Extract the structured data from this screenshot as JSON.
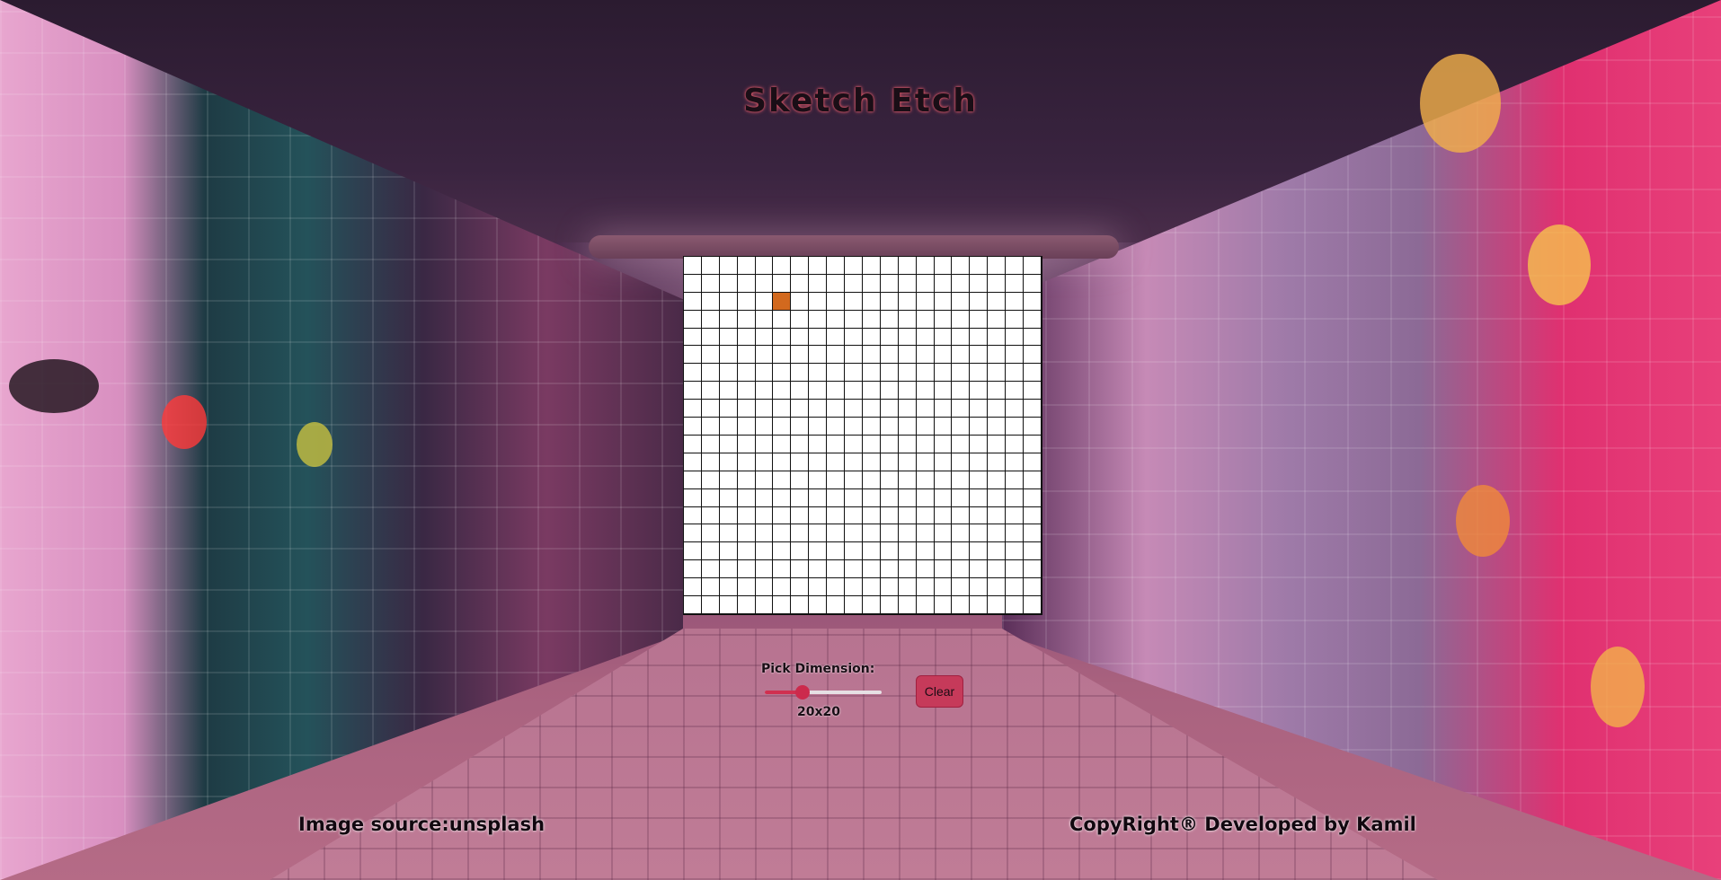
{
  "page": {
    "title": "Sketch Etch"
  },
  "grid": {
    "dimension": 20,
    "cell_color": "#ffffff",
    "line_color": "#111111",
    "paint_color": "#d2691e",
    "painted_cells": [
      [
        2,
        5
      ]
    ]
  },
  "controls": {
    "pick_label": "Pick Dimension:",
    "slider_fraction": 0.32,
    "dimension_text": "20x20",
    "clear_label": "Clear"
  },
  "footer": {
    "left_text": "Image source:unsplash",
    "right_text": "CopyRight® Developed by Kamil"
  },
  "colors": {
    "accent": "#cc2a4c",
    "title_glow": "#e05a6a"
  }
}
